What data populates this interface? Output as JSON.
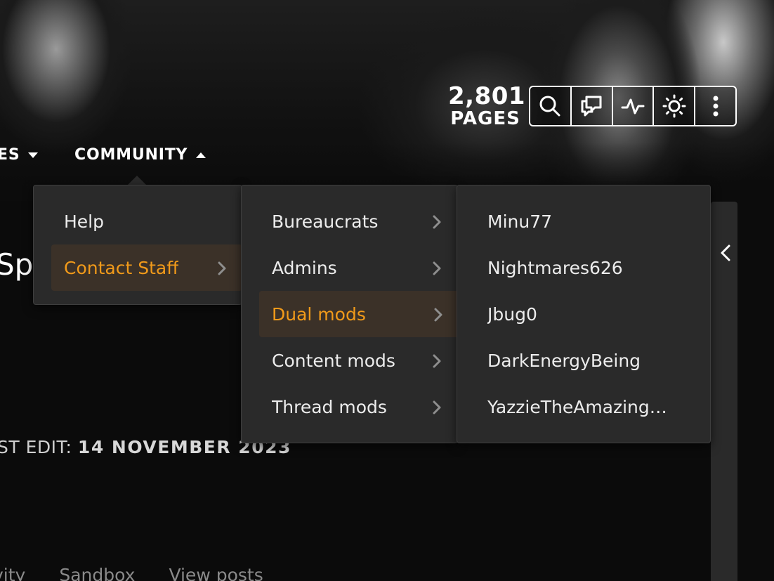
{
  "header": {
    "page_count": "2,801",
    "page_count_label": "PAGES",
    "tools": [
      {
        "icon": "search-icon"
      },
      {
        "icon": "discussions-icon"
      },
      {
        "icon": "activity-icon"
      },
      {
        "icon": "theme-toggle-icon"
      },
      {
        "icon": "more-options-icon"
      }
    ]
  },
  "nav": {
    "partial_item": "ES",
    "community_label": "COMMUNITY"
  },
  "page": {
    "title_fragment": "Spo",
    "last_edit_label": "ST EDIT:",
    "last_edit_date": "14 NOVEMBER 2023",
    "tabs": [
      "vity",
      "Sandbox",
      "View posts"
    ]
  },
  "menus": {
    "community": {
      "items": [
        {
          "label": "Help",
          "active": false,
          "has_submenu": false
        },
        {
          "label": "Contact Staff",
          "active": true,
          "has_submenu": true
        }
      ]
    },
    "contact_staff": {
      "items": [
        {
          "label": "Bureaucrats",
          "active": false
        },
        {
          "label": "Admins",
          "active": false
        },
        {
          "label": "Dual mods",
          "active": true
        },
        {
          "label": "Content mods",
          "active": false
        },
        {
          "label": "Thread mods",
          "active": false
        }
      ]
    },
    "dual_mods": {
      "items": [
        {
          "label": "Minu77"
        },
        {
          "label": "Nightmares626"
        },
        {
          "label": "Jbug0"
        },
        {
          "label": "DarkEnergyBeing"
        },
        {
          "label": "YazzieTheAmazing…"
        }
      ]
    }
  },
  "colors": {
    "accent": "#f19a1a",
    "menu_bg": "#2a2a2a",
    "active_bg": "#3b3128"
  }
}
